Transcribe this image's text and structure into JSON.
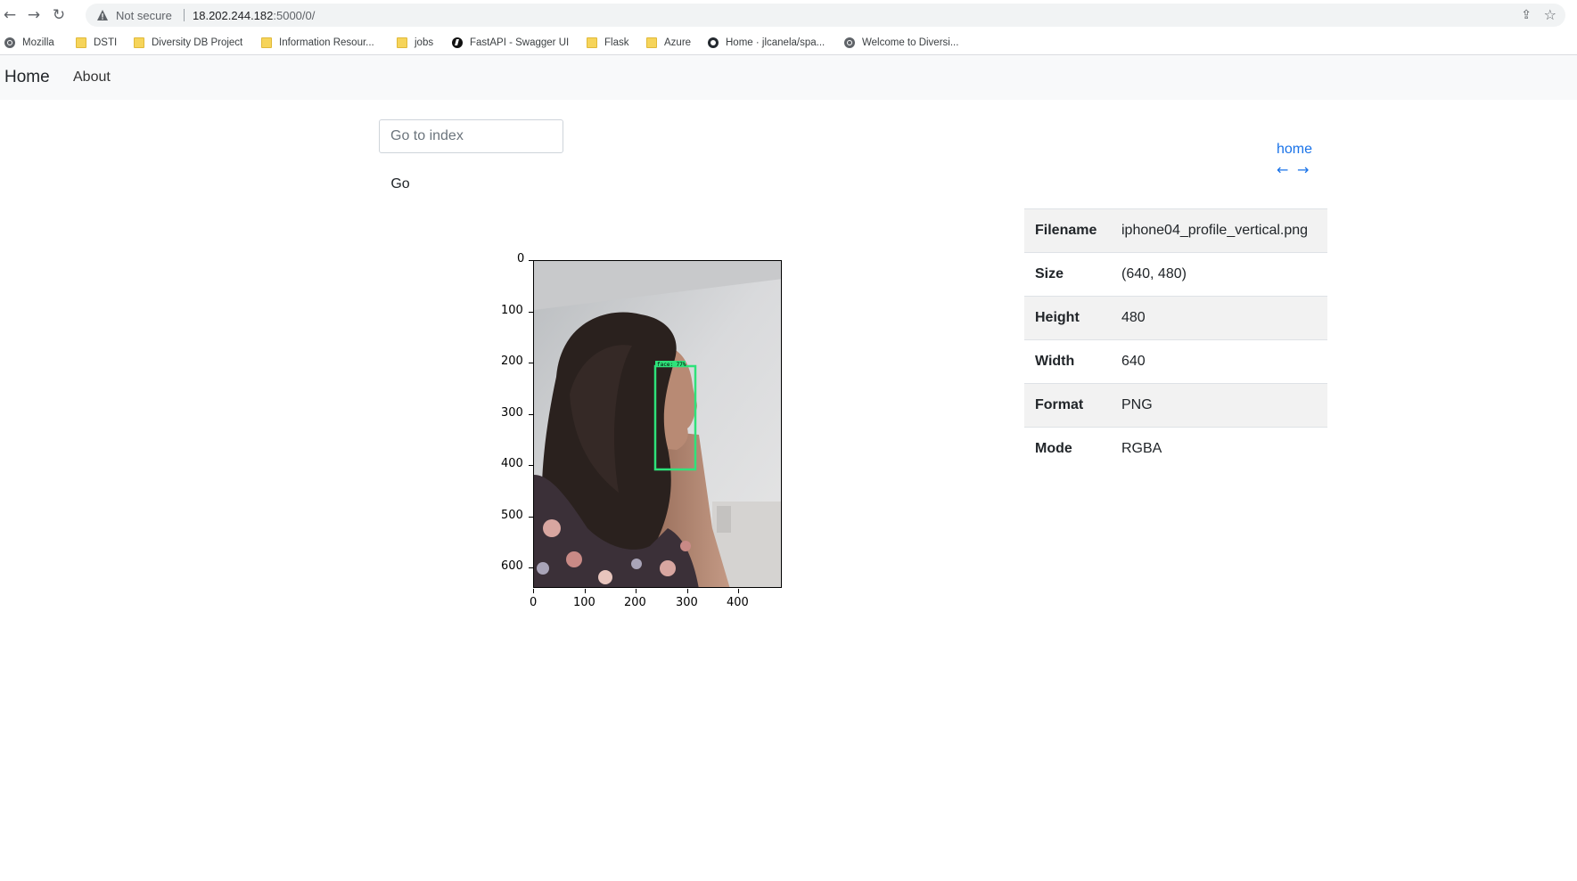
{
  "browser": {
    "security_label": "Not secure",
    "url_host": "18.202.244.182",
    "url_path": ":5000/0/",
    "bookmarks": [
      {
        "label": "Mozilla",
        "icon": "globe-icon"
      },
      {
        "label": "DSTI",
        "icon": "folder-icon"
      },
      {
        "label": "Diversity DB Project",
        "icon": "folder-icon"
      },
      {
        "label": "Information Resour...",
        "icon": "folder-icon"
      },
      {
        "label": "jobs",
        "icon": "folder-icon"
      },
      {
        "label": "FastAPI - Swagger UI",
        "icon": "fastapi-icon"
      },
      {
        "label": "Flask",
        "icon": "folder-icon"
      },
      {
        "label": "Azure",
        "icon": "folder-icon"
      },
      {
        "label": "Home · jlcanela/spa...",
        "icon": "github-icon"
      },
      {
        "label": "Welcome to Diversi...",
        "icon": "globe-icon"
      }
    ]
  },
  "navbar": {
    "brand": "Home",
    "about": "About"
  },
  "controls": {
    "index_placeholder": "Go to index",
    "go_label": "Go",
    "home_link": "home",
    "prev_arrow": "←",
    "next_arrow": "→"
  },
  "metadata": {
    "rows": [
      {
        "key": "Filename",
        "value": "iphone04_profile_vertical.png"
      },
      {
        "key": "Size",
        "value": "(640, 480)"
      },
      {
        "key": "Height",
        "value": "480"
      },
      {
        "key": "Width",
        "value": "640"
      },
      {
        "key": "Format",
        "value": "PNG"
      },
      {
        "key": "Mode",
        "value": "RGBA"
      }
    ]
  },
  "figure": {
    "y_ticks": [
      "0",
      "100",
      "200",
      "300",
      "400",
      "500",
      "600"
    ],
    "x_ticks": [
      "0",
      "100",
      "200",
      "300",
      "400"
    ],
    "detection_label": "face: 77%",
    "box_color": "#2ee27a"
  }
}
